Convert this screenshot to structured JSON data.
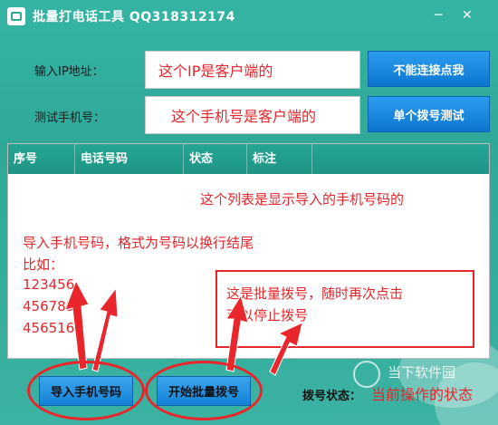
{
  "window": {
    "title": "批量打电话工具 QQ318312174",
    "minimize_glyph": "─",
    "close_glyph": "✕"
  },
  "form": {
    "ip_label": "输入IP地址：",
    "ip_value": "这个IP是客户端的",
    "connect_button": "不能连接点我",
    "phone_label": "测试手机号：",
    "phone_value": "这个手机号是客户端的",
    "test_button": "单个拨号测试"
  },
  "list": {
    "columns": [
      "序号",
      "电话号码",
      "状态",
      "标注"
    ],
    "note_top": "这个列表是显示导入的手机号码的",
    "note_import": "导入手机号码，格式为号码以换行结尾",
    "note_example": "比如：",
    "examples": [
      "123456",
      "456789",
      "4565165"
    ]
  },
  "callout": {
    "line1": "这是批量拨号，随时再次点击",
    "line2": "可以停止拨号"
  },
  "bottom": {
    "import_button": "导入手机号码",
    "start_button": "开始批量拨号",
    "status_label": "拨号状态：",
    "status_value": "当前操作的状态"
  },
  "watermark": "当下软件园",
  "colors": {
    "accent": "#2fa898",
    "annotation": "#e5262b",
    "button": "#1a86dc"
  }
}
